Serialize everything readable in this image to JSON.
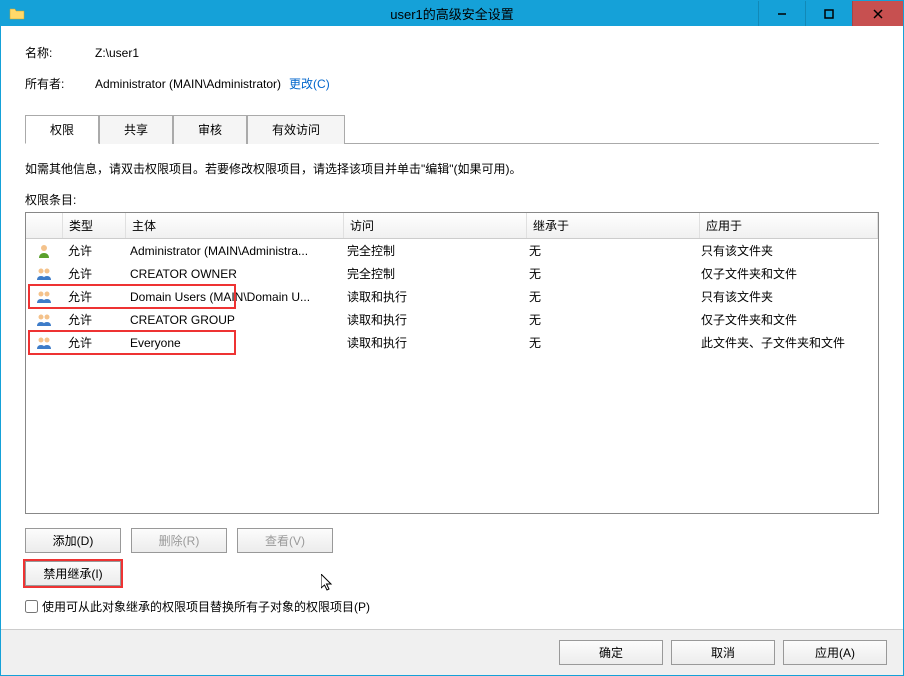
{
  "window": {
    "title": "user1的高级安全设置"
  },
  "header": {
    "name_label": "名称:",
    "name_value": "Z:\\user1",
    "owner_label": "所有者:",
    "owner_value": "Administrator (MAIN\\Administrator)",
    "change_link": "更改(C)"
  },
  "tabs": {
    "items": [
      {
        "label": "权限",
        "active": true
      },
      {
        "label": "共享",
        "active": false
      },
      {
        "label": "审核",
        "active": false
      },
      {
        "label": "有效访问",
        "active": false
      }
    ]
  },
  "hint": "如需其他信息，请双击权限项目。若要修改权限项目，请选择该项目并单击\"编辑\"(如果可用)。",
  "entries_label": "权限条目:",
  "columns": {
    "type": "类型",
    "principal": "主体",
    "access": "访问",
    "inherited_from": "继承于",
    "applies_to": "应用于"
  },
  "rows": [
    {
      "icon": "user-icon",
      "type": "允许",
      "principal": "Administrator (MAIN\\Administra...",
      "access": "完全控制",
      "inh": "无",
      "apply": "只有该文件夹",
      "highlight": false
    },
    {
      "icon": "group-icon",
      "type": "允许",
      "principal": "CREATOR OWNER",
      "access": "完全控制",
      "inh": "无",
      "apply": "仅子文件夹和文件",
      "highlight": false
    },
    {
      "icon": "group-icon",
      "type": "允许",
      "principal": "Domain Users (MAIN\\Domain U...",
      "access": "读取和执行",
      "inh": "无",
      "apply": "只有该文件夹",
      "highlight": true
    },
    {
      "icon": "group-icon",
      "type": "允许",
      "principal": "CREATOR GROUP",
      "access": "读取和执行",
      "inh": "无",
      "apply": "仅子文件夹和文件",
      "highlight": false
    },
    {
      "icon": "group-icon",
      "type": "允许",
      "principal": "Everyone",
      "access": "读取和执行",
      "inh": "无",
      "apply": "此文件夹、子文件夹和文件",
      "highlight": true
    }
  ],
  "buttons": {
    "add": "添加(D)",
    "remove": "删除(R)",
    "view": "查看(V)",
    "disable_inherit": "禁用继承(I)"
  },
  "checkbox": {
    "label": "使用可从此对象继承的权限项目替换所有子对象的权限项目(P)"
  },
  "bottom": {
    "ok": "确定",
    "cancel": "取消",
    "apply": "应用(A)"
  }
}
